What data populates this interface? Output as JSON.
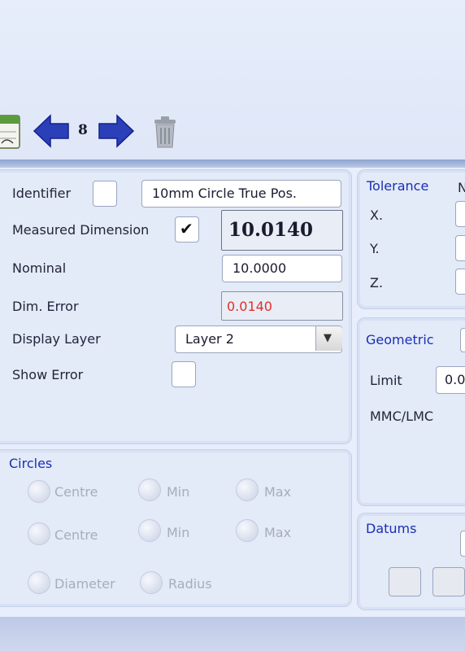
{
  "toolbar": {
    "calendar_icon": "calendar-icon",
    "back_icon": "arrow-left-icon",
    "counter": "8",
    "forward_icon": "arrow-right-icon",
    "trash_icon": "trash-icon"
  },
  "main_panel": {
    "identifier_label": "Identifier",
    "identifier_value": "10mm Circle True Pos.",
    "measured_label": "Measured Dimension",
    "measured_value": "10.0140",
    "measured_checked": "✔",
    "nominal_label": "Nominal",
    "nominal_value": "10.0000",
    "dim_error_label": "Dim. Error",
    "dim_error_value": "0.0140",
    "display_layer_label": "Display Layer",
    "display_layer_value": "Layer 2",
    "show_error_label": "Show Error"
  },
  "circles_panel": {
    "title": "Circles",
    "row1": [
      "Centre",
      "Min",
      "Max"
    ],
    "row2": [
      "Centre",
      "Min",
      "Max"
    ],
    "row3": [
      "Diameter",
      "Radius"
    ]
  },
  "tolerance_panel": {
    "title": "Tolerance",
    "col_header": "N",
    "x_label": "X.",
    "y_label": "Y.",
    "z_label": "Z."
  },
  "geometric_panel": {
    "title": "Geometric",
    "limit_label": "Limit",
    "limit_value": "0.0",
    "mmc_label": "MMC/LMC"
  },
  "datums_panel": {
    "title": "Datums"
  },
  "colors": {
    "accent_blue": "#1b2fb3",
    "error_red": "#e0302a"
  }
}
